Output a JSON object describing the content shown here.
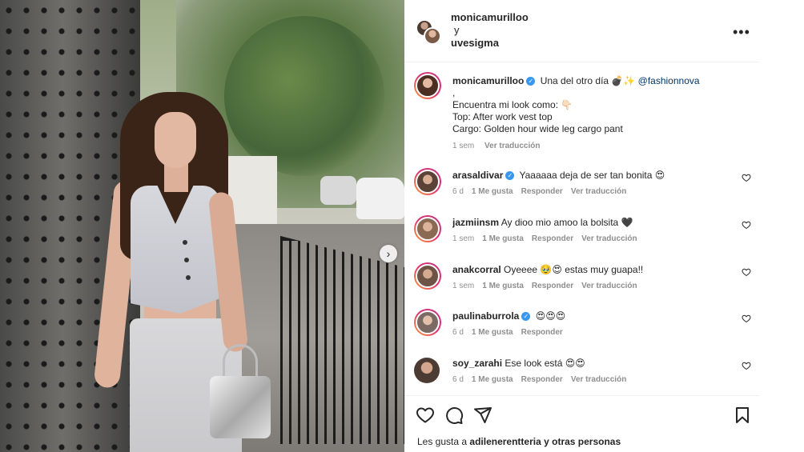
{
  "post": {
    "collab": {
      "user1": "monicamurilloo",
      "and": "y",
      "user2": "uvesigma"
    },
    "more_icon": "•••",
    "carousel_next": "›",
    "caption": {
      "username": "monicamurilloo",
      "text": "Una del otro día 💣✨",
      "mention": "@fashionnova",
      "dot": ",",
      "line1": "Encuentra mi look como: 👇🏻",
      "line2": "Top: After work vest top",
      "line3": "Cargo: Golden hour wide leg cargo pant",
      "time": "1 sem",
      "translate": "Ver traducción"
    },
    "comments": [
      {
        "username": "arasaldivar",
        "verified": true,
        "text": "Yaaaaaa deja de ser tan bonita 😍",
        "time": "6 d",
        "likes": "1 Me gusta",
        "reply": "Responder",
        "translate": "Ver traducción",
        "avatar_color": "#5a4237"
      },
      {
        "username": "jazmiinsm",
        "verified": false,
        "text": "Ay dioo mio amoo la bolsita 🖤",
        "time": "1 sem",
        "likes": "1 Me gusta",
        "reply": "Responder",
        "translate": "Ver traducción",
        "avatar_color": "#8a6a52"
      },
      {
        "username": "anakcorral",
        "verified": false,
        "text": "Oyeeee 🥹😍 estas muy guapa!!",
        "time": "1 sem",
        "likes": "1 Me gusta",
        "reply": "Responder",
        "translate": "Ver traducción",
        "avatar_color": "#6d5444"
      },
      {
        "username": "paulinaburrola",
        "verified": true,
        "text": "😍😍😍",
        "time": "6 d",
        "likes": "1 Me gusta",
        "reply": "Responder",
        "translate": "",
        "avatar_color": "#7b6a63"
      },
      {
        "username": "soy_zarahi",
        "verified": false,
        "text": "Ese look está 😍😍",
        "time": "6 d",
        "likes": "1 Me gusta",
        "reply": "Responder",
        "translate": "Ver traducción",
        "avatar_color": "#4c3b33"
      }
    ],
    "likes_line": {
      "prefix": "Les gusta a",
      "user": "adilenerentteria",
      "suffix": "y otras personas"
    }
  },
  "icons": {
    "like": "heart-outline-icon",
    "comment": "speech-bubble-icon",
    "share": "paper-plane-icon",
    "save": "bookmark-icon",
    "comment_like": "small-heart-icon"
  },
  "colors": {
    "accent_link": "#00376b",
    "verified": "#3897f0",
    "muted": "#8e8e8e",
    "text": "#262626"
  }
}
